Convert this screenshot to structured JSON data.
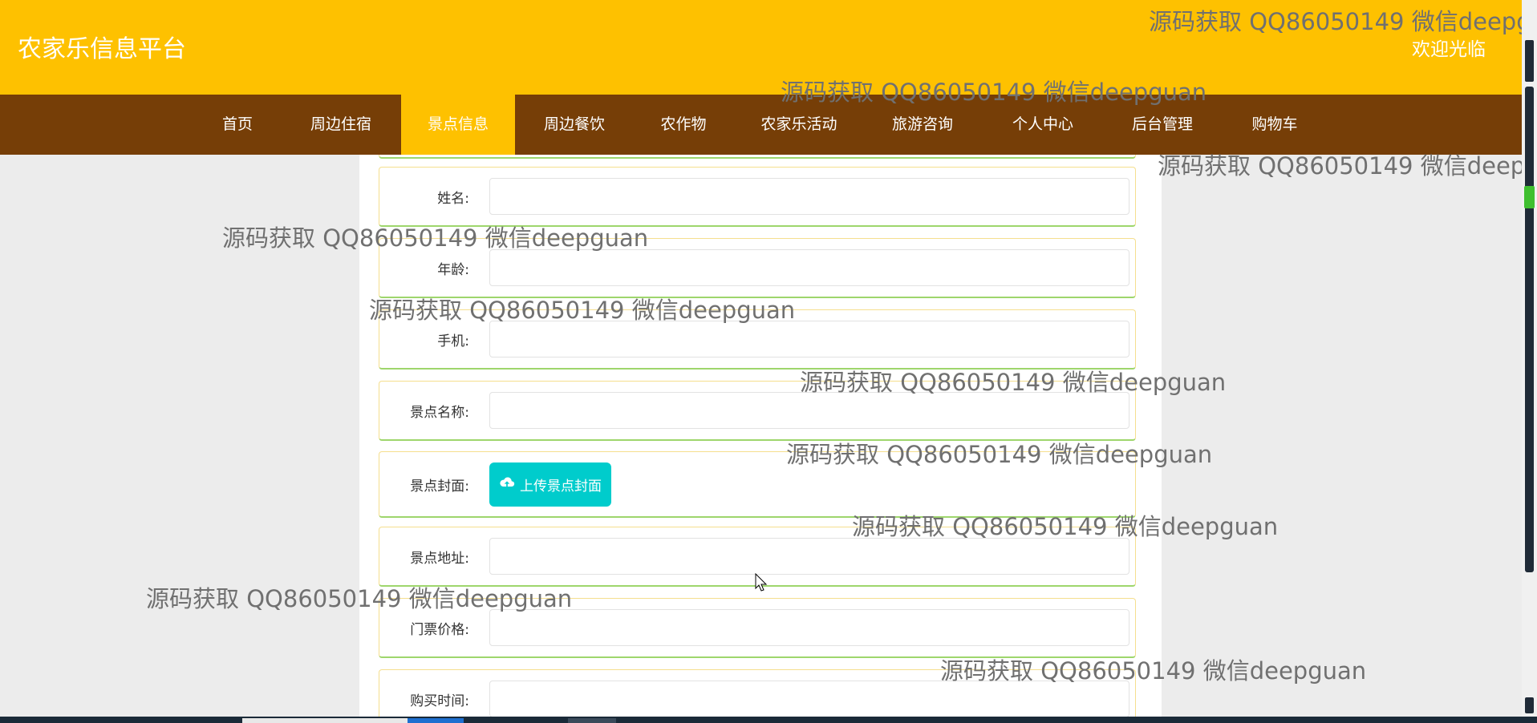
{
  "header": {
    "site_title": "农家乐信息平台",
    "welcome": "欢迎光临"
  },
  "nav": {
    "items": [
      {
        "label": "首页",
        "active": false
      },
      {
        "label": "周边住宿",
        "active": false
      },
      {
        "label": "景点信息",
        "active": true
      },
      {
        "label": "周边餐饮",
        "active": false
      },
      {
        "label": "农作物",
        "active": false
      },
      {
        "label": "农家乐活动",
        "active": false
      },
      {
        "label": "旅游咨询",
        "active": false
      },
      {
        "label": "个人中心",
        "active": false
      },
      {
        "label": "后台管理",
        "active": false
      },
      {
        "label": "购物车",
        "active": false
      }
    ]
  },
  "form": {
    "fields": [
      {
        "label": "姓名:",
        "value": ""
      },
      {
        "label": "年龄:",
        "value": ""
      },
      {
        "label": "手机:",
        "value": ""
      },
      {
        "label": "景点名称:",
        "value": ""
      },
      {
        "label": "景点封面:",
        "type": "upload",
        "button_label": "上传景点封面",
        "icon": "cloud-upload-icon"
      },
      {
        "label": "景点地址:",
        "value": ""
      },
      {
        "label": "门票价格:",
        "value": ""
      },
      {
        "label": "购买时间:",
        "value": ""
      }
    ]
  },
  "watermark": {
    "full": "源码获取 QQ86050149 微信deepguan",
    "truncated": "源码获取 QQ86050149 微信deepg"
  },
  "colors": {
    "header_bg": "#fec100",
    "nav_bg": "#763e07",
    "nav_active_bg": "#fec100",
    "upload_button_bg": "#00cccc",
    "page_bg": "#ececec"
  }
}
